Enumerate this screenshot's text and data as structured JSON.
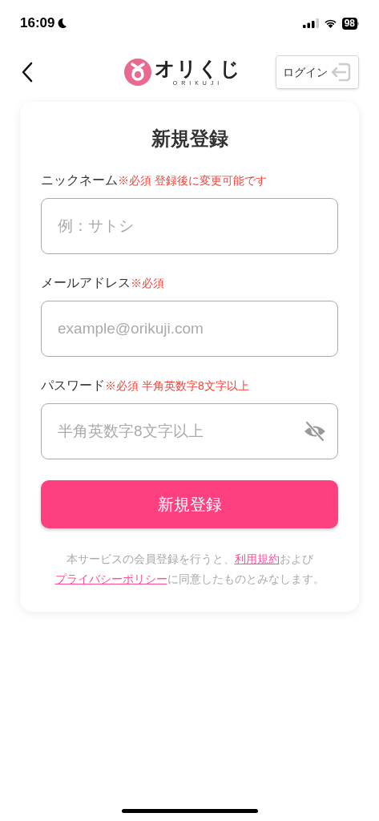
{
  "status_bar": {
    "time": "16:09",
    "battery": "98"
  },
  "header": {
    "logo_text": "オリくじ",
    "logo_subtext": "ORIKUJI",
    "login_button": "ログイン"
  },
  "form": {
    "title": "新規登録",
    "fields": [
      {
        "kind": "text",
        "label": "ニックネーム",
        "note": "※必須 登録後に変更可能です",
        "placeholder": "例：サトシ"
      },
      {
        "kind": "email",
        "label": "メールアドレス",
        "note": "※必須",
        "placeholder": "example@orikuji.com"
      },
      {
        "kind": "password",
        "label": "パスワード",
        "note": "※必須 半角英数字8文字以上",
        "placeholder": "半角英数字8文字以上"
      }
    ],
    "submit": "新規登録",
    "legal": [
      {
        "kind": "text",
        "text": "本サービスの会員登録を行うと、"
      },
      {
        "kind": "link",
        "text": "利用規約"
      },
      {
        "kind": "text",
        "text": "および"
      },
      {
        "kind": "break"
      },
      {
        "kind": "link",
        "text": "プライバシーポリシー"
      },
      {
        "kind": "text",
        "text": "に同意したものとみなします。"
      }
    ]
  }
}
